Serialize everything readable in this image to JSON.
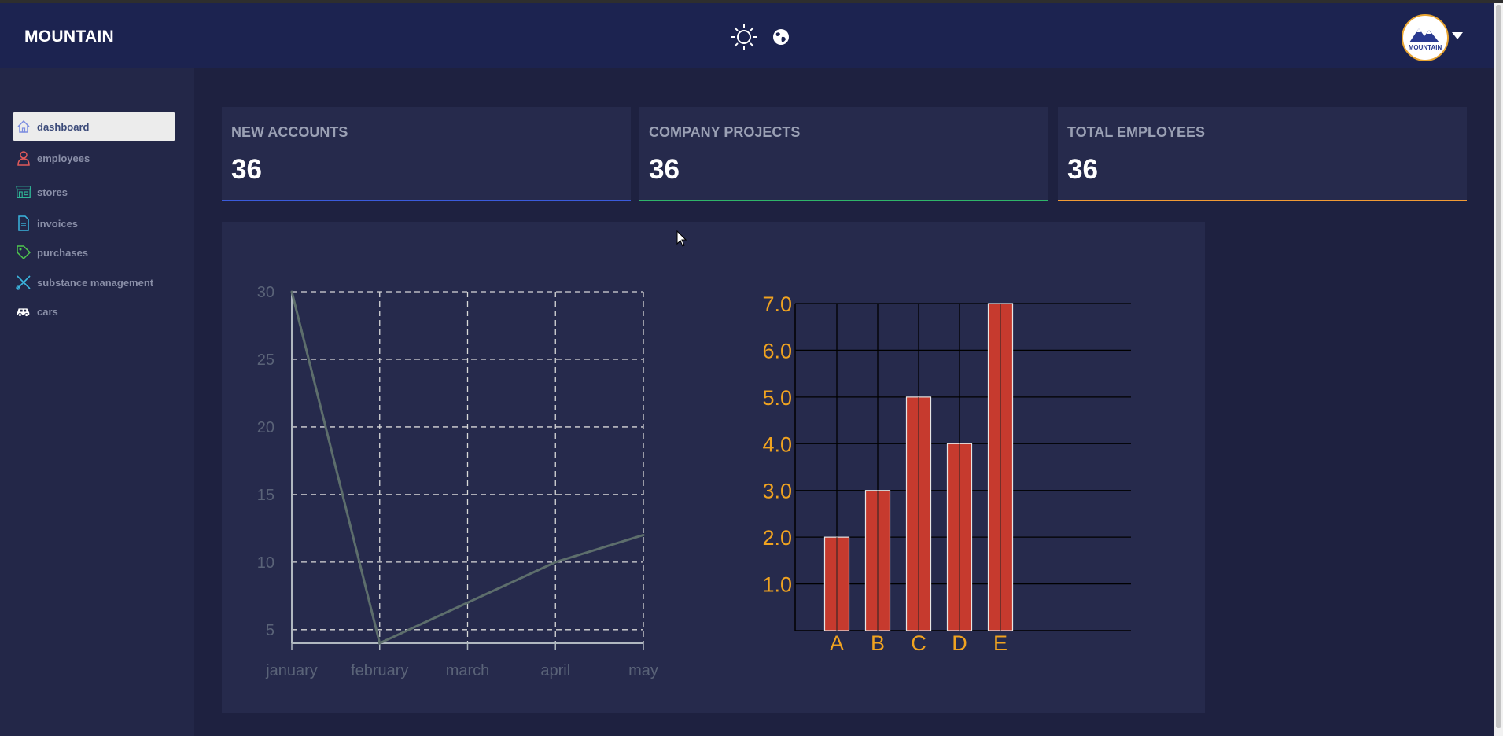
{
  "header": {
    "brand": "MOUNTAIN",
    "logo_text": "MOUNTAIN"
  },
  "icons": {
    "theme": "sun-icon",
    "language": "globe-icon",
    "menu": "chevron-down-icon"
  },
  "sidebar": {
    "items": [
      {
        "label": "dashboard",
        "icon": "home-icon",
        "color": "#7b8ce0",
        "active": true
      },
      {
        "label": "employees",
        "icon": "user-icon",
        "color": "#e05a5a"
      },
      {
        "label": "stores",
        "icon": "store-icon",
        "color": "#2fb596"
      },
      {
        "label": "invoices",
        "icon": "document-icon",
        "color": "#3bb6e0"
      },
      {
        "label": "purchases",
        "icon": "tag-icon",
        "color": "#4ec94e"
      },
      {
        "label": "substance management",
        "icon": "scissors-icon",
        "color": "#3bb6e0"
      },
      {
        "label": "cars",
        "icon": "car-icon",
        "color": "#ffffff"
      }
    ]
  },
  "cards": [
    {
      "title": "NEW ACCOUNTS",
      "value": "36",
      "accent": "#3b5bdb"
    },
    {
      "title": "COMPANY PROJECTS",
      "value": "36",
      "accent": "#2fb56a"
    },
    {
      "title": "TOTAL EMPLOYEES",
      "value": "36",
      "accent": "#f29b36"
    }
  ],
  "chart_data": [
    {
      "type": "line",
      "categories": [
        "january",
        "february",
        "march",
        "april",
        "may"
      ],
      "series": [
        {
          "values": [
            30,
            4,
            7,
            10,
            12
          ]
        }
      ],
      "yticks": [
        5,
        10,
        15,
        20,
        25,
        30
      ],
      "ylim": [
        4,
        30
      ],
      "grid": true,
      "colors": {
        "line": "#5d6e6c",
        "grid": "#d8d8d8",
        "axis": "#b0b8c0",
        "text": "#5a6378"
      }
    },
    {
      "type": "bar",
      "categories": [
        "A",
        "B",
        "C",
        "D",
        "E"
      ],
      "values": [
        2,
        3,
        5,
        4,
        7
      ],
      "yticks": [
        "1.0",
        "2.0",
        "3.0",
        "4.0",
        "5.0",
        "6.0",
        "7.0"
      ],
      "ylim": [
        0,
        7
      ],
      "grid": true,
      "colors": {
        "bar": "#c63a2e",
        "grid": "#000000",
        "text": "#f0a320"
      }
    }
  ]
}
